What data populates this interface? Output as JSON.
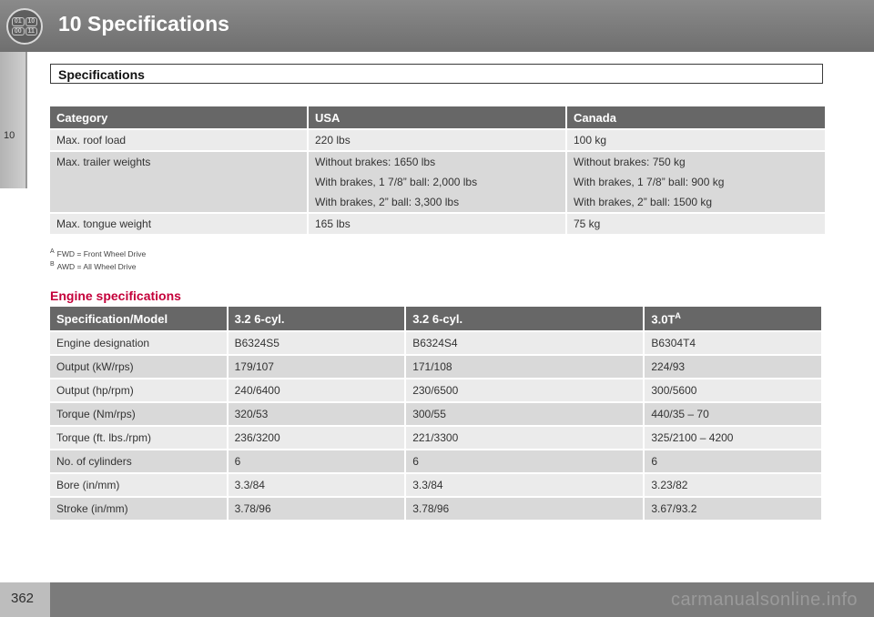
{
  "header": {
    "chapter_title": "10  Specifications",
    "icon_digits": [
      "01",
      "10",
      "00",
      "11"
    ]
  },
  "side_tab": {
    "number": "10"
  },
  "section": {
    "title": "Specifications"
  },
  "load_table": {
    "headers": [
      "Category",
      "USA",
      "Canada"
    ],
    "rows": [
      {
        "category": "Max. roof load",
        "usa": [
          "220 lbs"
        ],
        "canada": [
          "100 kg"
        ]
      },
      {
        "category": "Max. trailer weights",
        "usa": [
          "Without brakes: 1650 lbs",
          "With brakes, 1 7/8” ball: 2,000 lbs",
          "With brakes, 2” ball: 3,300 lbs"
        ],
        "canada": [
          "Without brakes: 750 kg",
          "With brakes, 1 7/8” ball: 900 kg",
          "With brakes, 2” ball: 1500 kg"
        ]
      },
      {
        "category": "Max. tongue weight",
        "usa": [
          "165 lbs"
        ],
        "canada": [
          "75 kg"
        ]
      }
    ]
  },
  "footnotes": [
    {
      "marker": "A",
      "text": "FWD = Front Wheel Drive"
    },
    {
      "marker": "B",
      "text": "AWD = All Wheel Drive"
    }
  ],
  "engine": {
    "heading": "Engine specifications",
    "headers": [
      "Specification/Model",
      "3.2 6-cyl.",
      "3.2 6-cyl.",
      "3.0T"
    ],
    "header_superscript": "A",
    "rows": [
      [
        "Engine designation",
        "B6324S5",
        "B6324S4",
        "B6304T4"
      ],
      [
        "Output (kW/rps)",
        "179/107",
        "171/108",
        "224/93"
      ],
      [
        "Output (hp/rpm)",
        "240/6400",
        "230/6500",
        "300/5600"
      ],
      [
        "Torque (Nm/rps)",
        "320/53",
        "300/55",
        "440/35 – 70"
      ],
      [
        "Torque (ft. lbs./rpm)",
        "236/3200",
        "221/3300",
        "325/2100 – 4200"
      ],
      [
        "No. of cylinders",
        "6",
        "6",
        "6"
      ],
      [
        "Bore (in/mm)",
        "3.3/84",
        "3.3/84",
        "3.23/82"
      ],
      [
        "Stroke (in/mm)",
        "3.78/96",
        "3.78/96",
        "3.67/93.2"
      ]
    ]
  },
  "footer": {
    "page_number": "362",
    "watermark": "carmanualsonline.info"
  },
  "colors": {
    "header_bar": "#7a7a7a",
    "table_header": "#676767",
    "row_dark": "#d9d9d9",
    "row_light": "#ebebeb",
    "accent_heading": "#c4003a"
  }
}
